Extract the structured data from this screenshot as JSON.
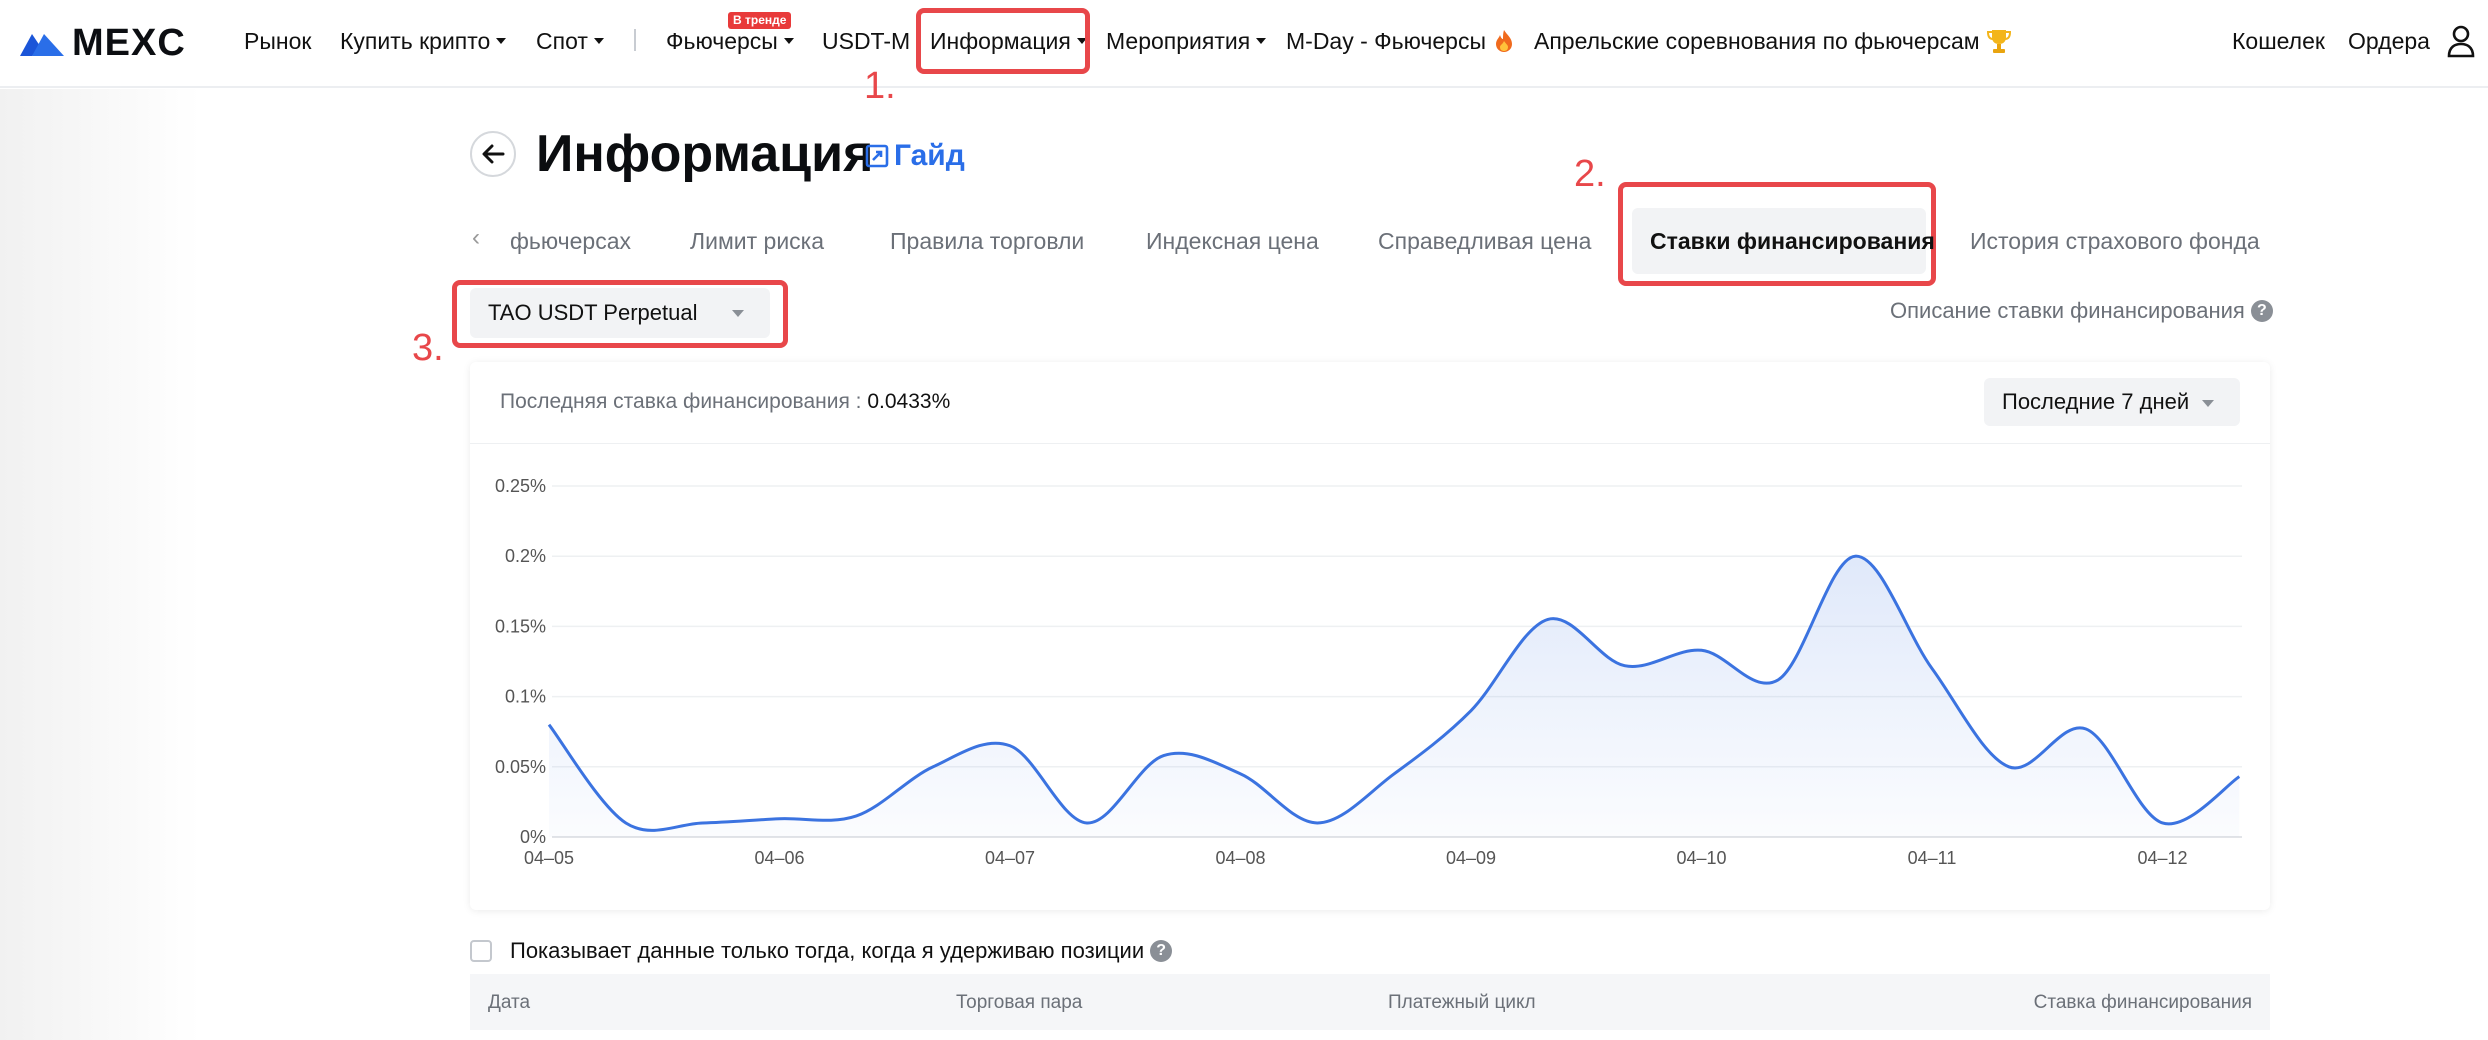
{
  "nav": {
    "logo": "MEXC",
    "items": [
      "Рынок",
      "Купить крипто",
      "Спот",
      "Фьючерсы",
      "USDT-M",
      "Информация",
      "Мероприятия",
      "M-Day - Фьючерсы",
      "Апрельские соревнования по фьючерсам"
    ],
    "trend_badge": "В тренде",
    "wallet": "Кошелек",
    "orders": "Ордера"
  },
  "annotations": [
    "1.",
    "2.",
    "3."
  ],
  "header": {
    "title": "Информация",
    "guide": "Гайд"
  },
  "tabs": [
    "фьючерсах",
    "Лимит риска",
    "Правила торговли",
    "Индексная цена",
    "Справедливая цена",
    "Ставки финансирования",
    "История страхового фонда"
  ],
  "contract_select": {
    "value": "TAO USDT Perpetual"
  },
  "rate_description": "Описание ставки финансирования",
  "card": {
    "last_rate_label": "Последняя ставка финансирования :",
    "last_rate_value": "0.0433%",
    "period": "Последние 7 дней"
  },
  "chart_data": {
    "type": "area",
    "x": [
      "04-05",
      "04-05 08h",
      "04-05 16h",
      "04-06",
      "04-06 08h",
      "04-06 16h",
      "04-07",
      "04-07 08h",
      "04-07 16h",
      "04-08",
      "04-08 08h",
      "04-08 16h",
      "04-09",
      "04-09 08h",
      "04-09 16h",
      "04-10",
      "04-10 08h",
      "04-10 16h",
      "04-11",
      "04-11 08h",
      "04-11 16h",
      "04-12",
      "04-12 08h"
    ],
    "values": [
      0.08,
      0.01,
      0.01,
      0.013,
      0.015,
      0.05,
      0.065,
      0.01,
      0.058,
      0.045,
      0.01,
      0.045,
      0.09,
      0.155,
      0.122,
      0.133,
      0.112,
      0.2,
      0.12,
      0.05,
      0.077,
      0.01,
      0.043
    ],
    "ylim": [
      0,
      0.25
    ],
    "yticks": [
      "0%",
      "0.05%",
      "0.1%",
      "0.15%",
      "0.2%",
      "0.25%"
    ],
    "xticks": [
      "04–05",
      "04–06",
      "04–07",
      "04–08",
      "04–09",
      "04–10",
      "04–11",
      "04–12"
    ],
    "grid": true,
    "color": "#3b73e0"
  },
  "filter": {
    "only_positions": "Показывает данные только тогда, когда я удерживаю позиции"
  },
  "table": {
    "headers": [
      "Дата",
      "Торговая пара",
      "Платежный цикл",
      "Ставка финансирования"
    ]
  }
}
